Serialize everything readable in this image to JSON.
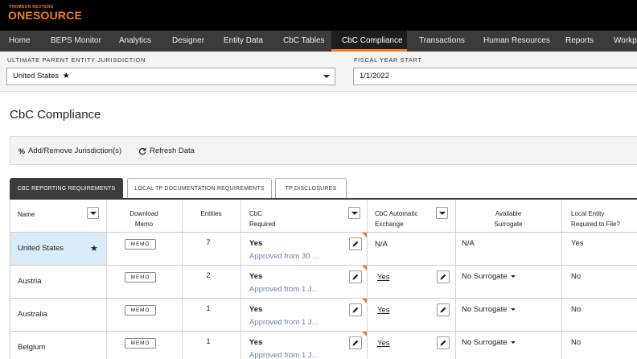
{
  "brand": {
    "small": "THOMSON REUTERS",
    "big": "ONESOURCE",
    "color": "#f47b20"
  },
  "nav": [
    {
      "label": "Home"
    },
    {
      "label": "BEPS Monitor"
    },
    {
      "label": "Analytics"
    },
    {
      "label": "Designer"
    },
    {
      "label": "Entity Data"
    },
    {
      "label": "CbC Tables"
    },
    {
      "label": "CbC Compliance",
      "active": true
    },
    {
      "label": "Transactions"
    },
    {
      "label": "Human Resources"
    },
    {
      "label": "Reports"
    },
    {
      "label": "Workpa"
    }
  ],
  "filters": {
    "jurisdiction_label": "ULTIMATE PARENT ENTITY JURISDICTION",
    "jurisdiction_value": "United States",
    "jurisdiction_icon": "star-icon",
    "fiscal_label": "FISCAL YEAR START",
    "fiscal_value": "1/1/2022"
  },
  "page_title": "CbC Compliance",
  "toolbar": {
    "add_remove": "Add/Remove Jurisdiction(s)",
    "add_remove_icon": "percent-icon",
    "refresh": "Refresh Data",
    "refresh_icon": "refresh-icon"
  },
  "tabs": [
    {
      "label": "CBC REPORTING REQUIREMENTS",
      "active": true
    },
    {
      "label": "LOCAL TP DOCUMENTATION REQUIREMENTS"
    },
    {
      "label": "TP DISCLOSURES"
    }
  ],
  "columns": {
    "name": "Name",
    "memo_1": "Download",
    "memo_2": "Memo",
    "entities": "Entities",
    "cbc_1": "CbC",
    "cbc_2": "Required",
    "ae_1": "CbC Automatic",
    "ae_2": "Exchange",
    "sur_1": "Available",
    "sur_2": "Surrogate",
    "loc_1": "Local Entity",
    "loc_2": "Required to File?"
  },
  "memo_label": "MEMO",
  "rows": [
    {
      "name": "United States",
      "starred": true,
      "entities": "7",
      "cbc": "Yes",
      "cbc_sub": "Approved from 30 ...",
      "ae": "N/A",
      "ae_link": false,
      "surrogate": "N/A",
      "surrogate_dropdown": false,
      "local": "Yes"
    },
    {
      "name": "Austria",
      "starred": false,
      "entities": "2",
      "cbc": "Yes",
      "cbc_sub": "Approved from 1 J...",
      "ae": "Yes",
      "ae_link": true,
      "surrogate": "No Surrogate",
      "surrogate_dropdown": true,
      "local": "No"
    },
    {
      "name": "Australia",
      "starred": false,
      "entities": "1",
      "cbc": "Yes",
      "cbc_sub": "Approved from 1 J...",
      "ae": "Yes",
      "ae_link": true,
      "surrogate": "No Surrogate",
      "surrogate_dropdown": true,
      "local": "No"
    },
    {
      "name": "Belgium",
      "starred": false,
      "entities": "1",
      "cbc": "Yes",
      "cbc_sub": "Approved from 1 J...",
      "ae": "Yes",
      "ae_link": true,
      "surrogate": "No Surrogate",
      "surrogate_dropdown": true,
      "local": "No"
    }
  ]
}
